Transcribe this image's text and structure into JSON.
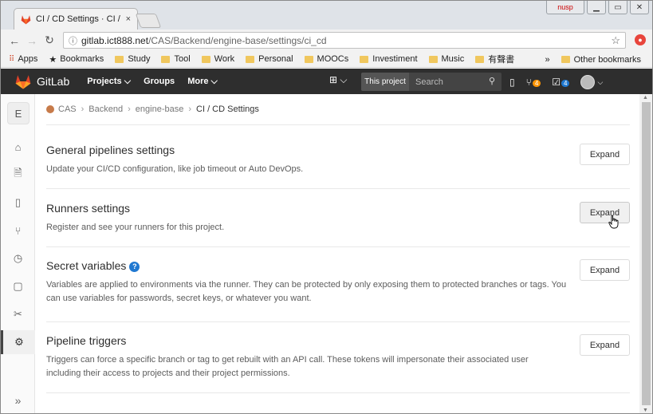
{
  "browser": {
    "tab_title": "CI / CD Settings · CI / CD",
    "tab_close": "×",
    "user_label": "nusp",
    "url_host": "gitlab.ict888.net",
    "url_path": "/CAS/Backend/engine-base/settings/ci_cd",
    "bookmarks": [
      "Apps",
      "Bookmarks",
      "Study",
      "Tool",
      "Work",
      "Personal",
      "MOOCs",
      "Investiment",
      "Music",
      "有聲書"
    ],
    "overflow": "»",
    "other_bookmarks": "Other bookmarks"
  },
  "header": {
    "brand": "GitLab",
    "nav": [
      "Projects ⌵",
      "Groups",
      "More ⌵"
    ],
    "search_scope": "This project",
    "search_placeholder": "Search",
    "mr_count": "4",
    "todo_count": "4"
  },
  "sidebar": {
    "project_initial": "E"
  },
  "breadcrumb": {
    "items": [
      "CAS",
      "Backend",
      "engine-base",
      "CI / CD Settings"
    ]
  },
  "sections": [
    {
      "title": "General pipelines settings",
      "description": "Update your CI/CD configuration, like job timeout or Auto DevOps.",
      "button": "Expand"
    },
    {
      "title": "Runners settings",
      "description": "Register and see your runners for this project.",
      "button": "Expand"
    },
    {
      "title": "Secret variables",
      "description": "Variables are applied to environments via the runner. They can be protected by only exposing them to protected branches or tags. You can use variables for passwords, secret keys, or whatever you want.",
      "button": "Expand"
    },
    {
      "title": "Pipeline triggers",
      "description": "Triggers can force a specific branch or tag to get rebuilt with an API call. These tokens will impersonate their associated user including their access to projects and their project permissions.",
      "button": "Expand"
    }
  ]
}
